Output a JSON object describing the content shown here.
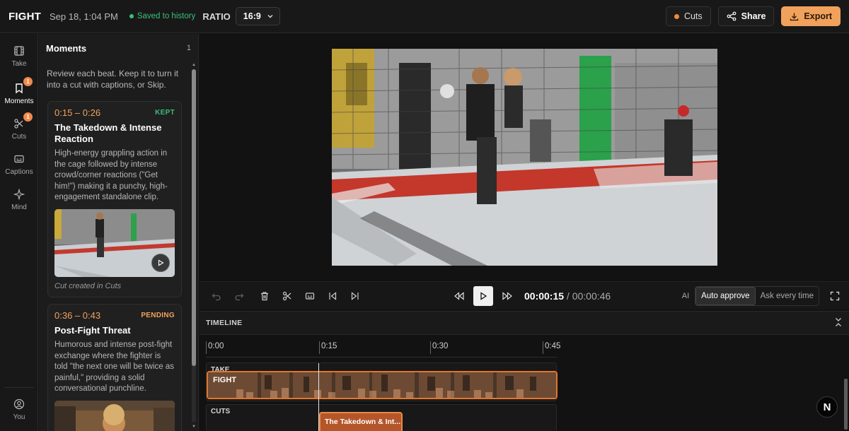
{
  "header": {
    "brand": "FIGHT",
    "date": "Sep 18, 1:04 PM",
    "saved": "Saved to history",
    "ratio_label": "RATIO",
    "ratio_value": "16:9",
    "cuts_label": "Cuts",
    "share_label": "Share",
    "export_label": "Export"
  },
  "rail": {
    "items": [
      {
        "label": "Take",
        "icon": "film-icon"
      },
      {
        "label": "Moments",
        "icon": "bookmark-icon",
        "badge": "1"
      },
      {
        "label": "Cuts",
        "icon": "scissors-icon",
        "badge": "1"
      },
      {
        "label": "Captions",
        "icon": "captions-icon"
      },
      {
        "label": "Mind",
        "icon": "sparkle-icon"
      }
    ],
    "user_label": "You"
  },
  "moments": {
    "title": "Moments",
    "count": "1",
    "description": "Review each beat. Keep it to turn it into a cut with captions, or Skip.",
    "cards": [
      {
        "time": "0:15 – 0:26",
        "status": "KEPT",
        "title": "The Takedown & Intense Reaction",
        "text": "High-energy grappling action in the cage followed by intense crowd/corner reactions (\"Get him!\") making it a punchy, high-engagement standalone clip.",
        "footer": "Cut created in Cuts"
      },
      {
        "time": "0:36 – 0:43",
        "status": "PENDING",
        "title": "Post-Fight Threat",
        "text": "Humorous and intense post-fight exchange where the fighter is told \"the next one will be twice as painful,\" providing a solid conversational punchline."
      }
    ]
  },
  "player": {
    "current_time": "00:00:15",
    "separator": " / ",
    "total_time": "00:00:46",
    "ai_label": "AI",
    "auto_approve": "Auto approve",
    "ask_every_time": "Ask every time"
  },
  "timeline": {
    "title": "TIMELINE",
    "ticks": [
      "0:00",
      "0:15",
      "0:30",
      "0:45"
    ],
    "take_lane_label": "TAKE",
    "take_name": "FIGHT",
    "cuts_lane_label": "CUTS",
    "cut_clip_label": "The Takedown & Int..."
  },
  "fab": {
    "label": "N"
  },
  "colors": {
    "accent": "#f0a25c",
    "kept": "#3bbd79",
    "saved": "#39c07b",
    "clip": "#e2762e"
  }
}
